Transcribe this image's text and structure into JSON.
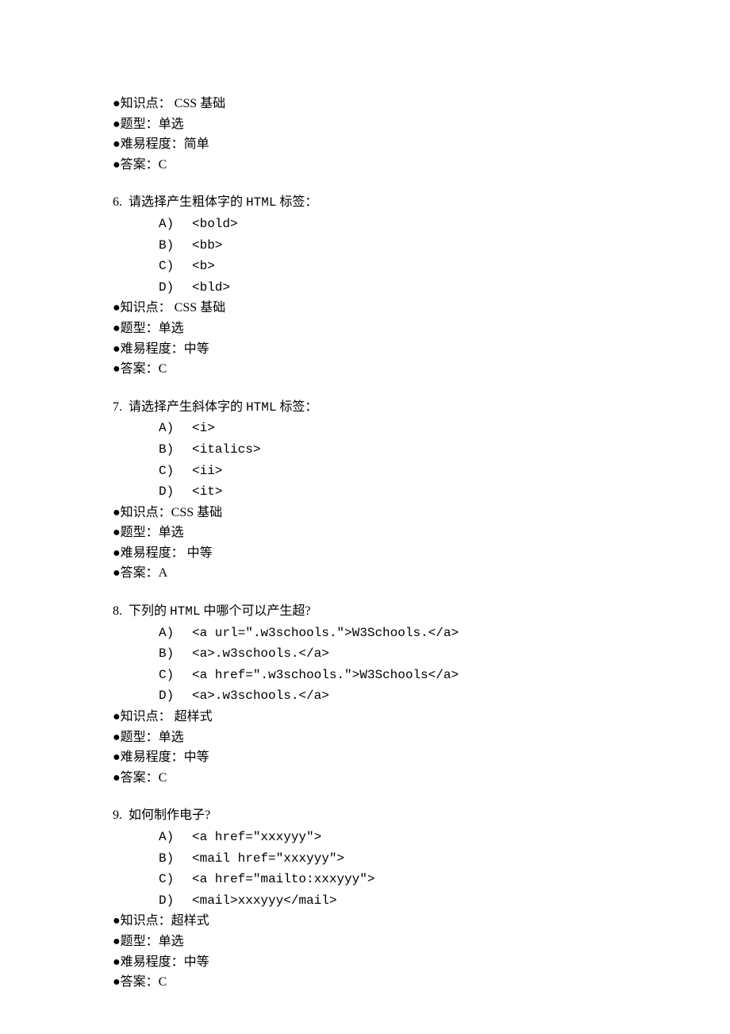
{
  "labels": {
    "knowledge": "●知识点：",
    "qtype": "●题型：",
    "difficulty": "●难易程度：",
    "answer": "●答案："
  },
  "opt_labels": [
    "A)",
    "B)",
    "C)",
    "D)"
  ],
  "partial_meta": {
    "knowledge": " CSS 基础",
    "qtype": "单选",
    "difficulty": "简单",
    "answer": "C"
  },
  "questions": [
    {
      "num": "6.",
      "stem_pre": "请选择产生粗体字的 ",
      "stem_en": "HTML",
      "stem_post": " 标签：",
      "options": [
        "<bold>",
        "<bb>",
        "<b>",
        "<bld>"
      ],
      "knowledge": " CSS 基础",
      "qtype": "单选",
      "difficulty": "中等",
      "answer": "C"
    },
    {
      "num": "7.",
      "stem_pre": "请选择产生斜体字的 ",
      "stem_en": "HTML",
      "stem_post": " 标签：",
      "options": [
        "<i>",
        "<italics>",
        "<ii>",
        "<it>"
      ],
      "knowledge": "CSS 基础",
      "qtype": "单选",
      "difficulty": " 中等",
      "answer": "A"
    },
    {
      "num": "8.",
      "stem_pre": "下列的 ",
      "stem_en": "HTML",
      "stem_post": " 中哪个可以产生超?",
      "options": [
        "<a url=\".w3schools.\">W3Schools.</a>",
        "<a>.w3schools.</a>",
        "<a href=\".w3schools.\">W3Schools</a>",
        "<a>.w3schools.</a>"
      ],
      "knowledge": " 超样式",
      "qtype": "单选",
      "difficulty": "中等",
      "answer": "C"
    },
    {
      "num": "9.",
      "stem_pre": "如何制作电子?",
      "stem_en": "",
      "stem_post": "",
      "options": [
        "<a href=\"xxxyyy\">",
        "<mail href=\"xxxyyy\">",
        "<a href=\"mailto:xxxyyy\">",
        "<mail>xxxyyy</mail>"
      ],
      "knowledge": "超样式",
      "qtype": "单选",
      "difficulty": "中等",
      "answer": "C"
    }
  ]
}
